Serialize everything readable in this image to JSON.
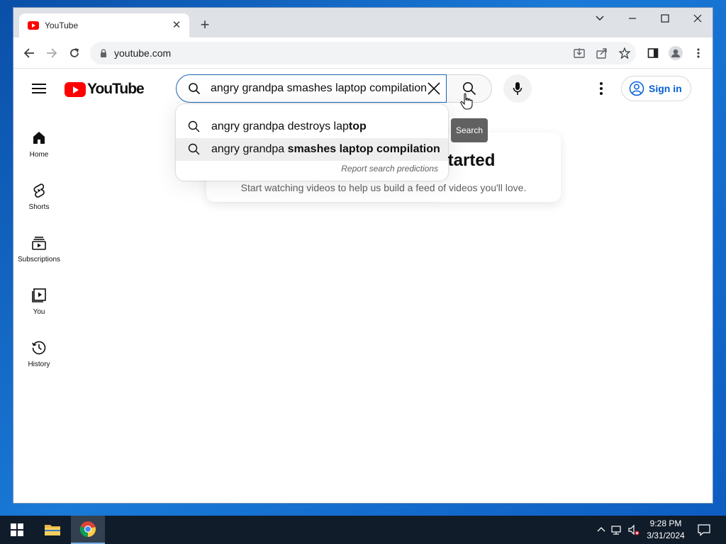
{
  "browser": {
    "tab_title": "YouTube",
    "url": "youtube.com"
  },
  "youtube": {
    "logo_text": "YouTube",
    "search_value": "angry grandpa smashes laptop compilation",
    "search_tooltip": "Search",
    "signin_label": "Sign in",
    "sidebar": [
      {
        "label": "Home",
        "icon": "home-icon"
      },
      {
        "label": "Shorts",
        "icon": "shorts-icon"
      },
      {
        "label": "Subscriptions",
        "icon": "subscriptions-icon"
      },
      {
        "label": "You",
        "icon": "you-icon"
      },
      {
        "label": "History",
        "icon": "history-icon"
      }
    ],
    "suggestions": [
      {
        "prefix": "angry grandpa destroys lap",
        "bold": "top",
        "active": false
      },
      {
        "prefix": "angry grandpa ",
        "bold": "smashes laptop compilation",
        "active": true
      }
    ],
    "report_predictions": "Report search predictions",
    "card_title": "Try searching to get started",
    "card_subtitle": "Start watching videos to help us build a feed of videos you'll love."
  },
  "taskbar": {
    "time": "9:28 PM",
    "date": "3/31/2024"
  }
}
